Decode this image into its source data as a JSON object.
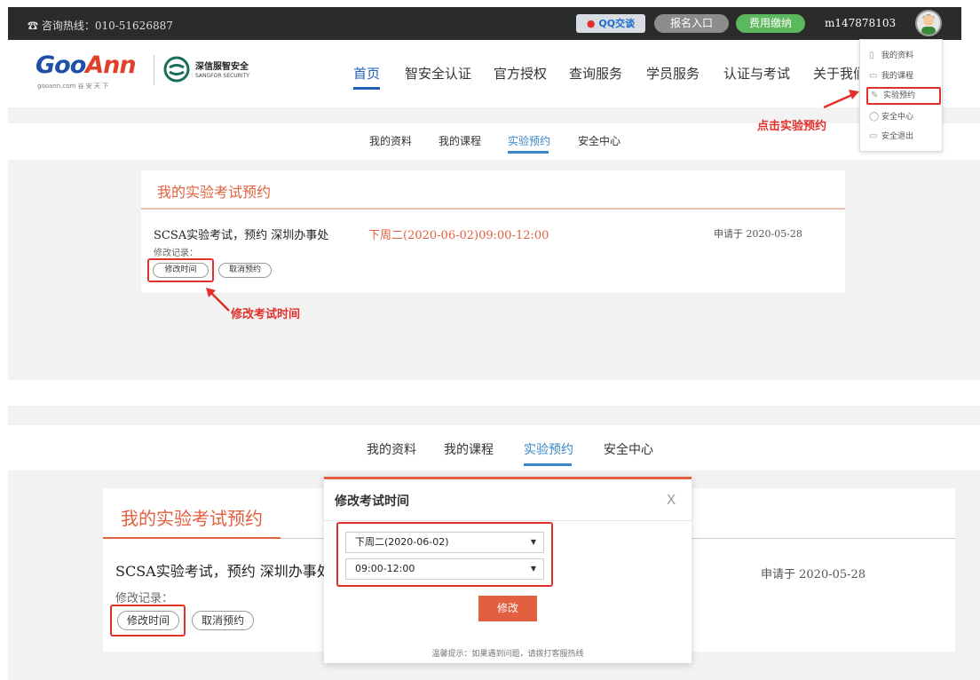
{
  "topbar": {
    "hotline": "☎ 咨询热线：010-51626887",
    "qq_label": "QQ交谈",
    "signup_label": "报名入口",
    "fee_label": "费用缴纳",
    "username": "m147878103"
  },
  "header": {
    "logo_goo": "Goo",
    "logo_ann": "Ann",
    "logo_sub": "gooann.com 谷 安 天 下",
    "partner_name": "深信服智安全",
    "partner_en": "SANGFOR SECURITY",
    "nav": [
      "首页",
      "智安全认证",
      "官方授权",
      "查询服务",
      "学员服务",
      "认证与考试",
      "关于我们"
    ]
  },
  "user_menu": {
    "items": [
      "我的资料",
      "我的课程",
      "实验预约",
      "安全中心",
      "安全退出"
    ]
  },
  "annotations": {
    "click_lab": "点击实验预约",
    "modify_time": "修改考试时间"
  },
  "subtabs": [
    "我的资料",
    "我的课程",
    "实验预约",
    "安全中心"
  ],
  "booking": {
    "title": "我的实验考试预约",
    "exam": "SCSA实验考试，预约 深圳办事处",
    "exam_date": "下周二(2020-06-02)09:00-12:00",
    "applied": "申请于 2020-05-28",
    "mod_record": "修改记录：",
    "modify_btn": "修改时间",
    "cancel_btn": "取消预约"
  },
  "modal": {
    "title": "修改考试时间",
    "close": "X",
    "date_value": "下周二(2020-06-02)",
    "time_value": "09:00-12:00",
    "submit": "修改",
    "tip": "温馨提示：如果遇到问题，请拨打客服热线"
  },
  "colors": {
    "accent_orange": "#e2603f",
    "nav_blue": "#1f5fb8",
    "highlight_red": "#e2302a"
  }
}
